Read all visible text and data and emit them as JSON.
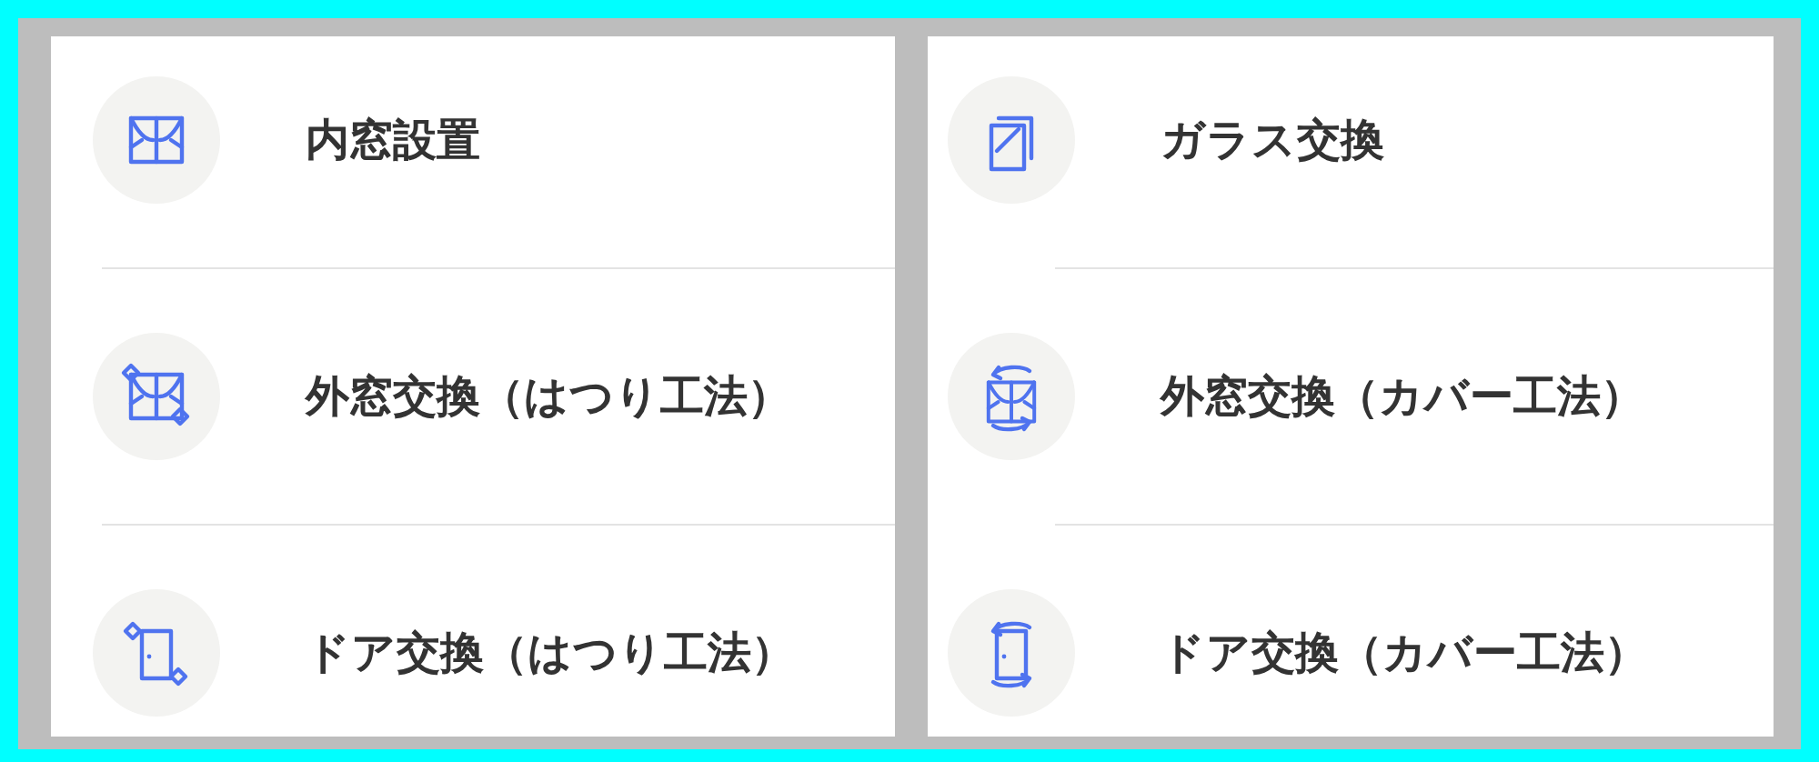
{
  "columns": [
    {
      "items": [
        {
          "label": "内窓設置"
        },
        {
          "label": "外窓交換（はつり工法）"
        },
        {
          "label": "ドア交換（はつり工法）"
        }
      ]
    },
    {
      "items": [
        {
          "label": "ガラス交換"
        },
        {
          "label": "外窓交換（カバー工法）"
        },
        {
          "label": "ドア交換（カバー工法）"
        }
      ]
    }
  ]
}
